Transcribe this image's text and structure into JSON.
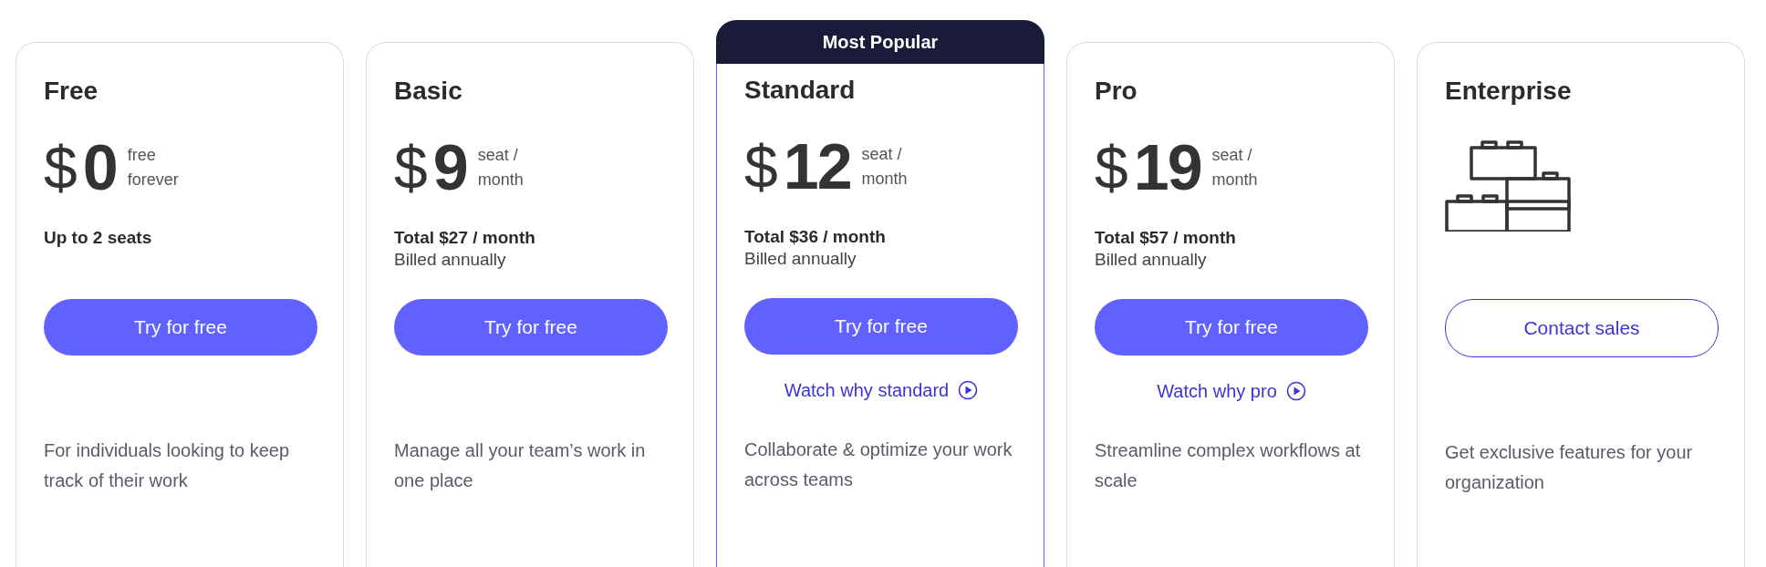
{
  "plans": [
    {
      "name": "Free",
      "highlighted": false,
      "hero": {
        "kind": "price",
        "currency": "$",
        "amount": "0",
        "unit": "free\nforever"
      },
      "summary": "Up to 2 seats",
      "button": {
        "label": "Try for free",
        "kind": "primary"
      },
      "description": "For individuals looking to keep track of their work"
    },
    {
      "name": "Basic",
      "highlighted": false,
      "hero": {
        "kind": "price",
        "currency": "$",
        "amount": "9",
        "unit": "seat /\nmonth"
      },
      "summary": "Total $27 / month",
      "note": "Billed annually",
      "button": {
        "label": "Try for free",
        "kind": "primary"
      },
      "description": "Manage all your team’s work in one place"
    },
    {
      "name": "Standard",
      "badge": "Most Popular",
      "highlighted": true,
      "hero": {
        "kind": "price",
        "currency": "$",
        "amount": "12",
        "unit": "seat /\nmonth"
      },
      "summary": "Total $36 / month",
      "note": "Billed annually",
      "button": {
        "label": "Try for free",
        "kind": "primary"
      },
      "video_link": "Watch why standard",
      "description": "Collaborate & optimize your work across teams"
    },
    {
      "name": "Pro",
      "highlighted": false,
      "hero": {
        "kind": "price",
        "currency": "$",
        "amount": "19",
        "unit": "seat /\nmonth"
      },
      "summary": "Total $57 / month",
      "note": "Billed annually",
      "button": {
        "label": "Try for free",
        "kind": "primary"
      },
      "video_link": "Watch why pro",
      "description": "Streamline complex workflows at scale"
    },
    {
      "name": "Enterprise",
      "highlighted": false,
      "hero": {
        "kind": "icon"
      },
      "button": {
        "label": "Contact sales",
        "kind": "outline"
      },
      "description": "Get exclusive features for your organization"
    }
  ]
}
